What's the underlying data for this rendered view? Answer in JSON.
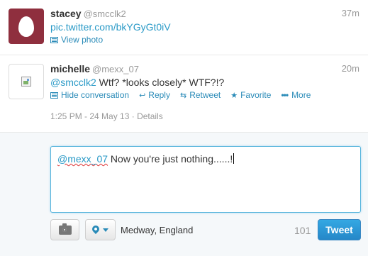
{
  "tweets": [
    {
      "fullname": "stacey",
      "username": "@smcclk2",
      "time": "37m",
      "link": "pic.twitter.com/bkYGyGt0iV",
      "view_photo": "View photo"
    },
    {
      "fullname": "michelle",
      "username": "@mexx_07",
      "time": "20m",
      "mention": "@smcclk2",
      "text": " Wtf? *looks closely* WTF?!?",
      "actions": {
        "hide": "Hide conversation",
        "reply": "Reply",
        "retweet": "Retweet",
        "favorite": "Favorite",
        "more": "More"
      },
      "date": "1:25 PM - 24 May 13",
      "separator": "·",
      "details": "Details"
    }
  ],
  "reply": {
    "mention": "@mexx_07",
    "text": " Now you're just nothing......!",
    "location": "Medway, England",
    "char_count": "101",
    "tweet_label": "Tweet"
  },
  "icons": {
    "reply": "↩",
    "retweet": "⇆",
    "favorite": "★",
    "more": "•••"
  },
  "colors": {
    "link": "#2a9ac7",
    "tweet_button": "#2587c8",
    "avatar_stacey": "#8f2f3e"
  }
}
